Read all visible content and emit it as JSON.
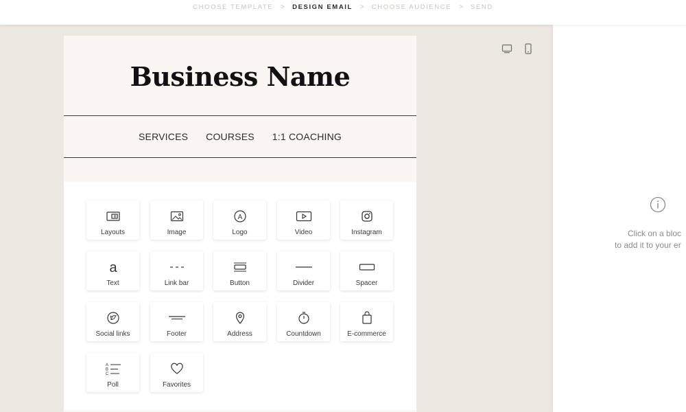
{
  "steps": [
    {
      "label": "CHOOSE TEMPLATE",
      "active": false
    },
    {
      "label": "DESIGN EMAIL",
      "active": true
    },
    {
      "label": "CHOOSE AUDIENCE",
      "active": false
    },
    {
      "label": "SEND",
      "active": false
    }
  ],
  "separator": ">",
  "device_toggle": {
    "desktop_icon": "desktop-icon",
    "mobile_icon": "mobile-icon"
  },
  "email": {
    "business_name": "Business Name",
    "nav": [
      "SERVICES",
      "COURSES",
      "1:1 COACHING"
    ]
  },
  "blocks": [
    {
      "label": "Layouts",
      "icon": "layouts-icon"
    },
    {
      "label": "Image",
      "icon": "image-icon"
    },
    {
      "label": "Logo",
      "icon": "logo-icon"
    },
    {
      "label": "Video",
      "icon": "video-icon"
    },
    {
      "label": "Instagram",
      "icon": "instagram-icon"
    },
    {
      "label": "Text",
      "icon": "text-icon"
    },
    {
      "label": "Link bar",
      "icon": "link-bar-icon"
    },
    {
      "label": "Button",
      "icon": "button-icon"
    },
    {
      "label": "Divider",
      "icon": "divider-icon"
    },
    {
      "label": "Spacer",
      "icon": "spacer-icon"
    },
    {
      "label": "Social links",
      "icon": "social-links-icon"
    },
    {
      "label": "Footer",
      "icon": "footer-icon"
    },
    {
      "label": "Address",
      "icon": "address-icon"
    },
    {
      "label": "Countdown",
      "icon": "countdown-icon"
    },
    {
      "label": "E-commerce",
      "icon": "e-commerce-icon"
    },
    {
      "label": "Poll",
      "icon": "poll-icon"
    },
    {
      "label": "Favorites",
      "icon": "favorites-icon"
    }
  ],
  "side_panel": {
    "icon": "info-icon",
    "hint_line1": "Click on a bloc",
    "hint_line2": "to add it to your er"
  },
  "colors": {
    "canvas_bg": "#ebe7e1",
    "email_bg": "#faf6f2",
    "text_dark": "#111111",
    "muted": "#8a8a8a"
  }
}
